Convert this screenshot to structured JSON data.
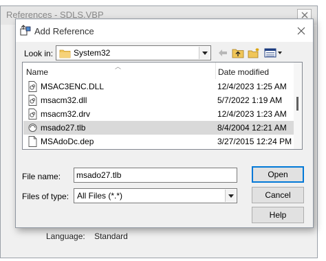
{
  "background_window": {
    "title": "References - SDLS.VBP",
    "language_label": "Language:",
    "language_value": "Standard"
  },
  "dialog": {
    "title": "Add Reference",
    "look_in_label": "Look in:",
    "look_in_value": "System32",
    "columns": {
      "name": "Name",
      "date": "Date modified"
    },
    "files": [
      {
        "name": "MSAC3ENC.DLL",
        "date": "12/4/2023 1:25 AM",
        "icon": "dll-file-icon",
        "selected": false
      },
      {
        "name": "msacm32.dll",
        "date": "5/7/2022 1:19 AM",
        "icon": "dll-file-icon",
        "selected": false
      },
      {
        "name": "msacm32.drv",
        "date": "12/4/2023 1:23 AM",
        "icon": "drv-file-icon",
        "selected": false
      },
      {
        "name": "msado27.tlb",
        "date": "8/4/2004 12:21 AM",
        "icon": "tlb-file-icon",
        "selected": true
      },
      {
        "name": "MSAdoDc.dep",
        "date": "3/27/2015 12:24 PM",
        "icon": "generic-file-icon",
        "selected": false
      }
    ],
    "file_name_label": "File name:",
    "file_name_value": "msado27.tlb",
    "file_type_label": "Files of type:",
    "file_type_value": "All Files (*.*)",
    "buttons": {
      "open": "Open",
      "cancel": "Cancel",
      "help": "Help"
    }
  },
  "colors": {
    "dialog_bg": "#f0f0f0",
    "selection": "#d9d9d9",
    "folder": "#e8b54a",
    "default_button_border": "#0078d7"
  }
}
